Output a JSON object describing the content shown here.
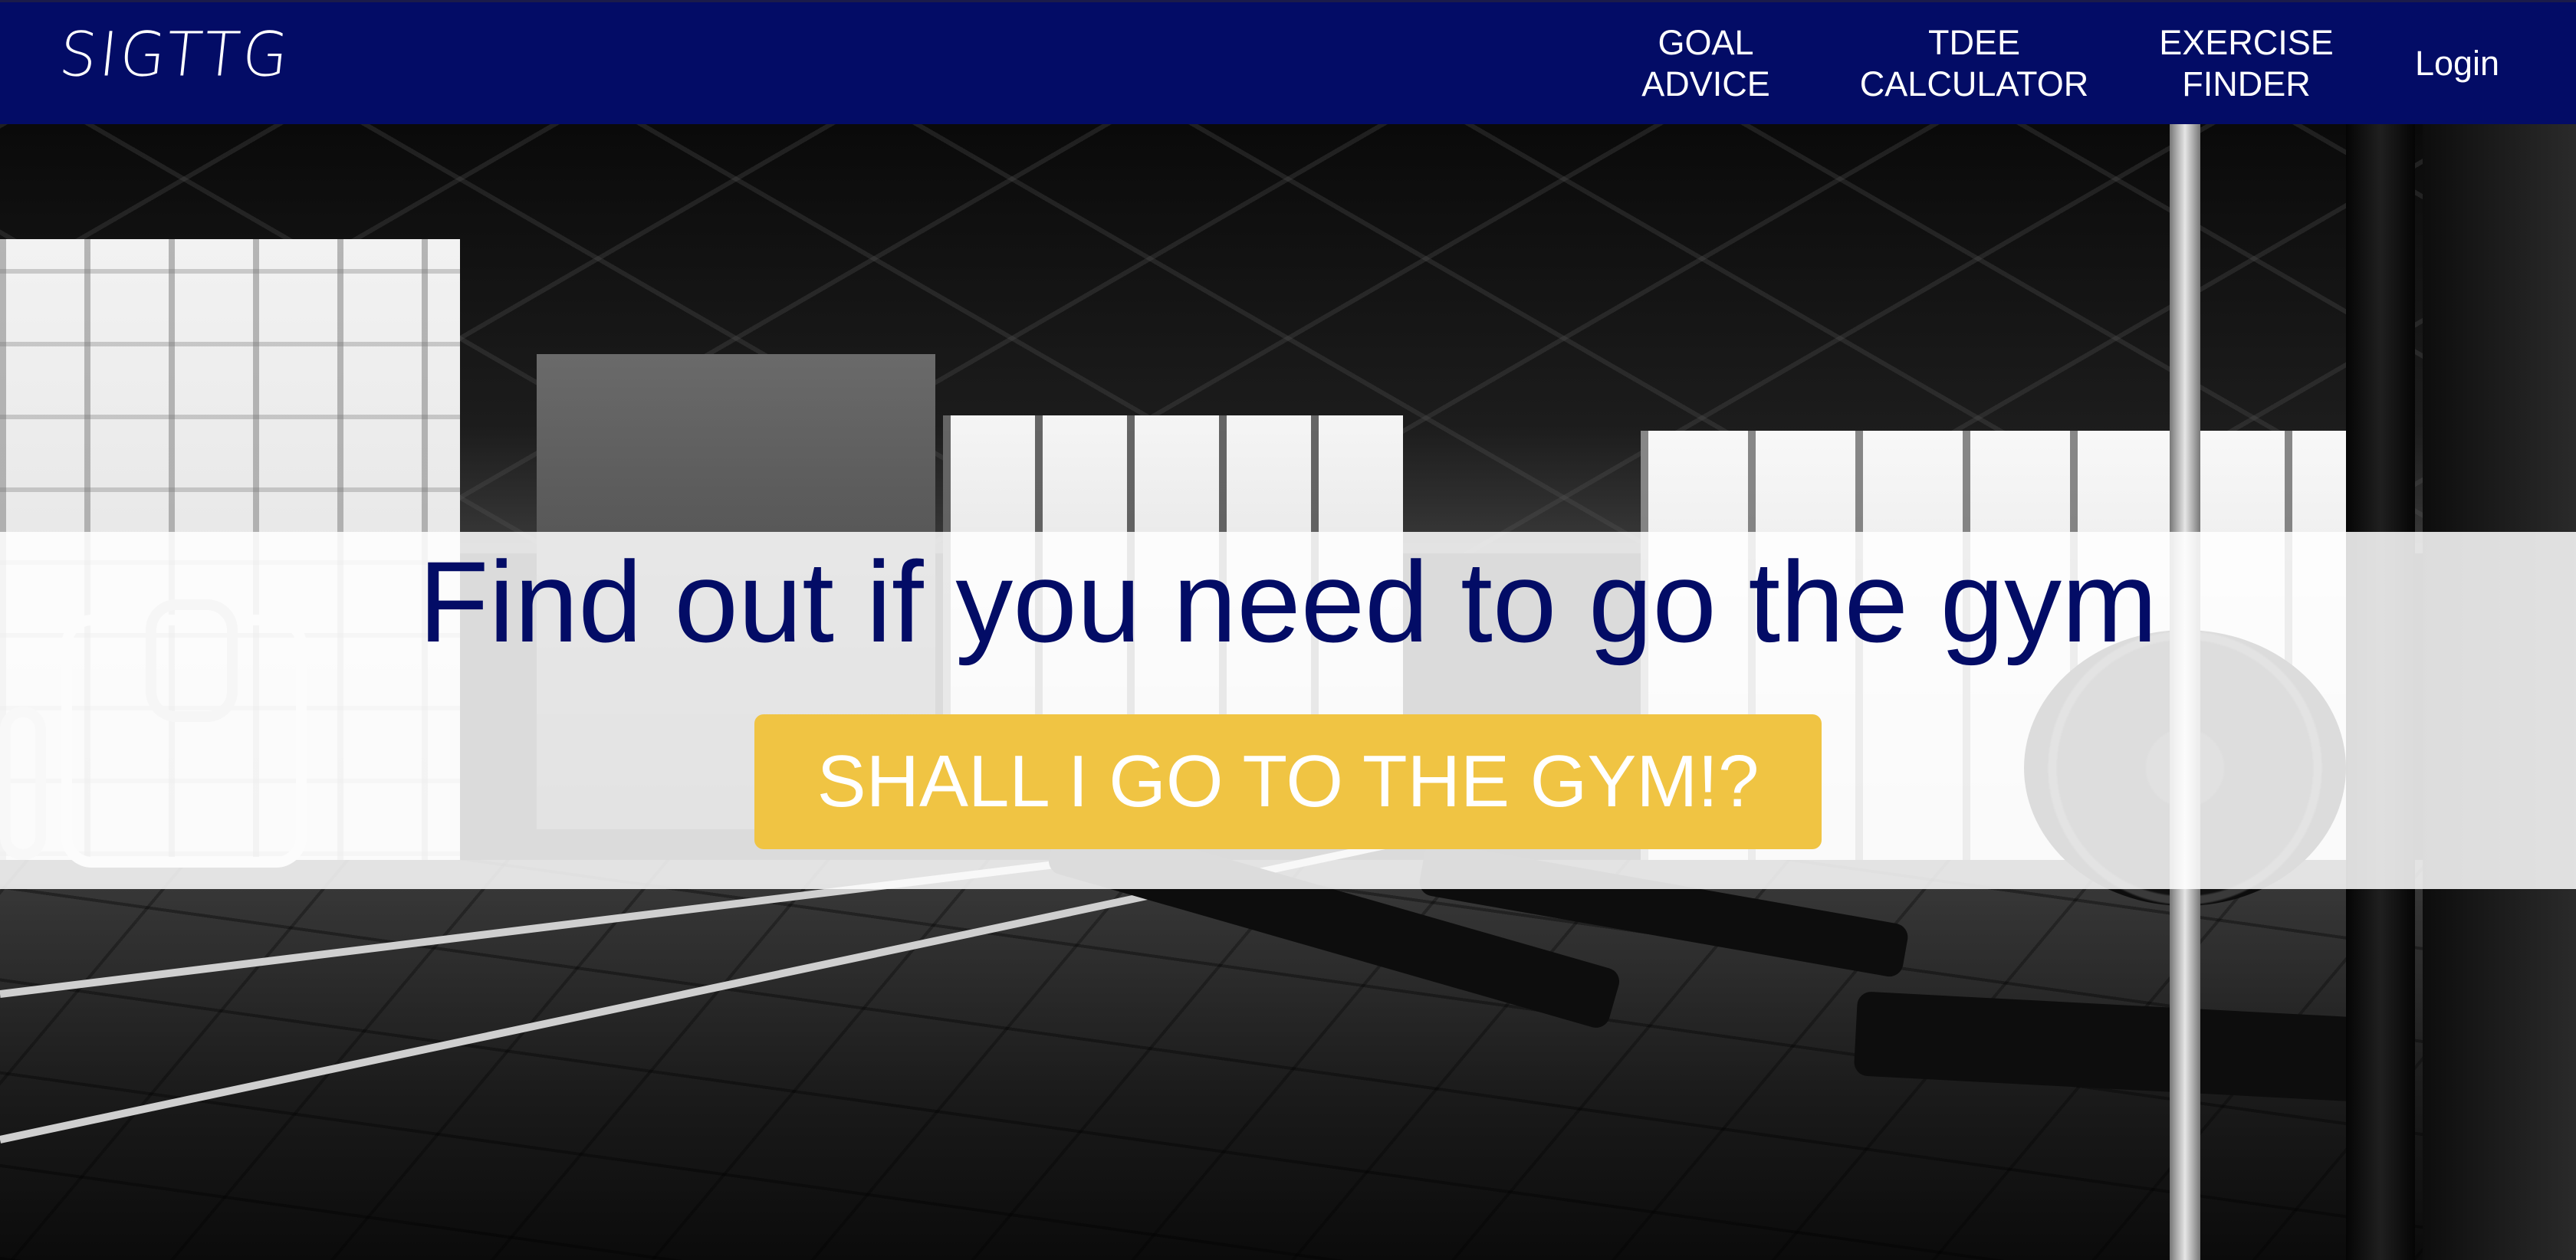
{
  "navbar": {
    "logo_text": "SIGTTG",
    "links": [
      {
        "label": "GOAL\nADVICE"
      },
      {
        "label": "TDEE\nCALCULATOR"
      },
      {
        "label": "EXERCISE\nFINDER"
      },
      {
        "label": "Login"
      }
    ]
  },
  "hero": {
    "headline": "Find out if you need to go the gym",
    "cta_label": "SHALL I GO TO THE GYM!?"
  },
  "colors": {
    "navbar_background": "#030c66",
    "headline_color": "#030c66",
    "cta_background": "#f0c443",
    "cta_text": "#ffffff"
  }
}
